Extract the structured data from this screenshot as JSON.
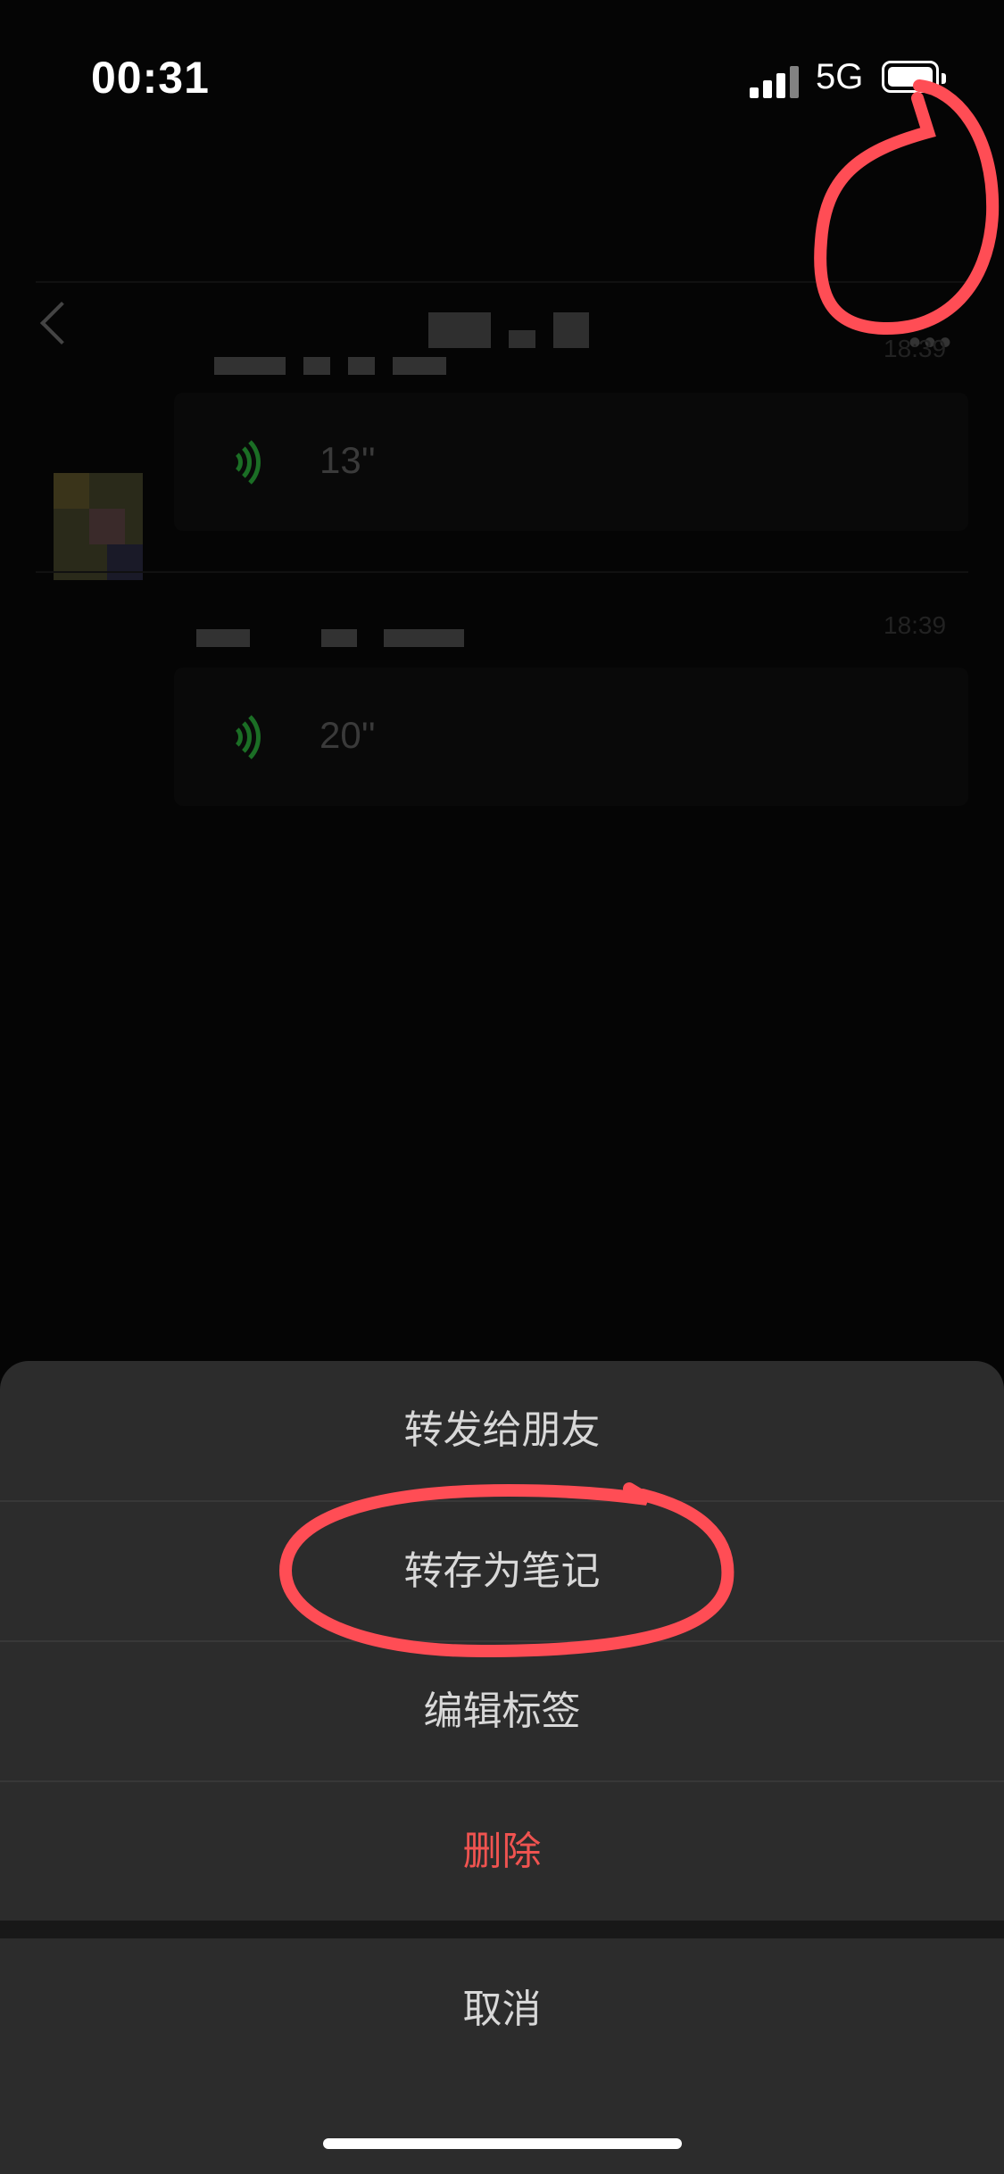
{
  "status_bar": {
    "time": "00:31",
    "network": "5G",
    "signal": "4 bars",
    "battery": "full"
  },
  "header": {
    "date": "2022-10-31"
  },
  "messages": [
    {
      "timestamp": "18:39",
      "duration": "13''"
    },
    {
      "timestamp": "18:39",
      "duration": "20''"
    }
  ],
  "action_sheet": {
    "items": [
      {
        "label": "转发给朋友",
        "style": "normal"
      },
      {
        "label": "转存为笔记",
        "style": "normal"
      },
      {
        "label": "编辑标签",
        "style": "normal"
      },
      {
        "label": "删除",
        "style": "danger"
      }
    ],
    "cancel_label": "取消"
  },
  "colors": {
    "annotation": "#ff4d55",
    "danger": "#ef5350",
    "sheet_bg": "#2c2c2c",
    "voice_icon": "#1b6e25"
  },
  "icons": [
    "back-chevron-icon",
    "more-icon",
    "voice-wave-icon"
  ]
}
